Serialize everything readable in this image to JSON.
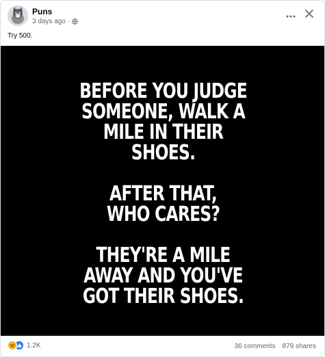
{
  "post": {
    "page_name": "Puns",
    "timestamp": "3 days ago",
    "separator": "·",
    "privacy_icon": "globe-icon",
    "caption": "Try 500.",
    "more_icon": "more-options-icon",
    "close_icon": "close-icon"
  },
  "image": {
    "background": "#000000",
    "stanzas": [
      [
        "BEFORE YOU JUDGE",
        "SOMEONE, WALK A",
        "MILE IN THEIR",
        "SHOES."
      ],
      [
        "AFTER THAT,",
        "WHO CARES?"
      ],
      [
        "THEY'RE A MILE",
        "AWAY AND YOU'VE",
        "GOT THEIR SHOES."
      ]
    ]
  },
  "footer": {
    "reaction_icons": [
      "haha-icon",
      "like-icon"
    ],
    "reaction_count": "1.2K",
    "comments": "36 comments",
    "shares": "879 shares"
  },
  "colors": {
    "like": "#1877f2",
    "haha": "#f7b125",
    "secondary_text": "#65676b"
  }
}
